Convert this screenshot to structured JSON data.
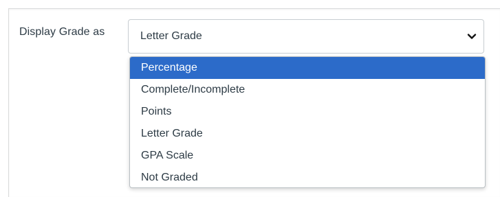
{
  "field": {
    "label": "Display Grade as",
    "selected_value": "Letter Grade",
    "chevron_icon": "chevron-down-icon"
  },
  "dropdown": {
    "highlighted_index": 0,
    "highlight_color": "#2c6bc9",
    "options": [
      {
        "label": "Percentage"
      },
      {
        "label": "Complete/Incomplete"
      },
      {
        "label": "Points"
      },
      {
        "label": "Letter Grade"
      },
      {
        "label": "GPA Scale"
      },
      {
        "label": "Not Graded"
      }
    ]
  }
}
